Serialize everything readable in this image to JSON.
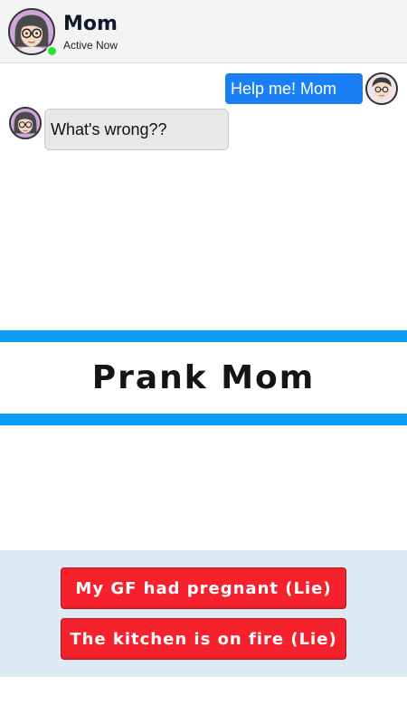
{
  "header": {
    "contact_name": "Mom",
    "status": "Active Now",
    "online_color": "#21e62b"
  },
  "chat": {
    "messages": [
      {
        "sender": "me",
        "text": "Help me! Mom"
      },
      {
        "sender": "mom",
        "text": "What's wrong??"
      }
    ]
  },
  "banner": {
    "title": "Prank Mom",
    "accent_color": "#0b9cf6"
  },
  "choices": [
    {
      "label": "My GF had pregnant (Lie)"
    },
    {
      "label": "The kitchen is on fire (Lie)"
    }
  ],
  "colors": {
    "sent_bubble": "#1a7ff5",
    "received_bubble": "#e8e8e8",
    "choice_button": "#f5222d",
    "choices_panel": "#dcebf3"
  }
}
